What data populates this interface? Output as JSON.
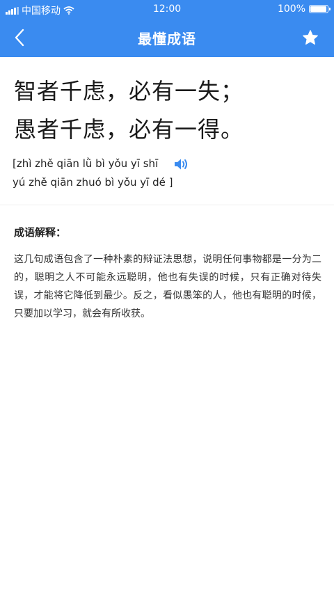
{
  "status_bar": {
    "carrier": "中国移动",
    "time": "12:00",
    "battery": "100%",
    "battery_level": 1.0
  },
  "nav": {
    "title": "最懂成语",
    "back_icon": "chevron-left-icon",
    "favorite_icon": "star-icon"
  },
  "idiom": {
    "line1": "智者千虑，必有一失；",
    "line2": "愚者千虑，必有一得。"
  },
  "pinyin": {
    "line1": "[zhì zhě qiān lǜ bì yǒu yī shī",
    "line2": "yú zhě qiān zhuó bì yǒu yī dé ]",
    "speaker_icon": "speaker-icon"
  },
  "explanation": {
    "heading": "成语解释：",
    "body": "这几句成语包含了一种朴素的辩证法思想，说明任何事物都是一分为二的，聪明之人不可能永远聪明，他也有失误的时候，只有正确对待失误，才能将它降低到最少。反之，看似愚笨的人，他也有聪明的时候，只要加以学习，就会有所收获。"
  },
  "colors": {
    "primary": "#3a8bf0",
    "speaker": "#3a8bf0"
  }
}
